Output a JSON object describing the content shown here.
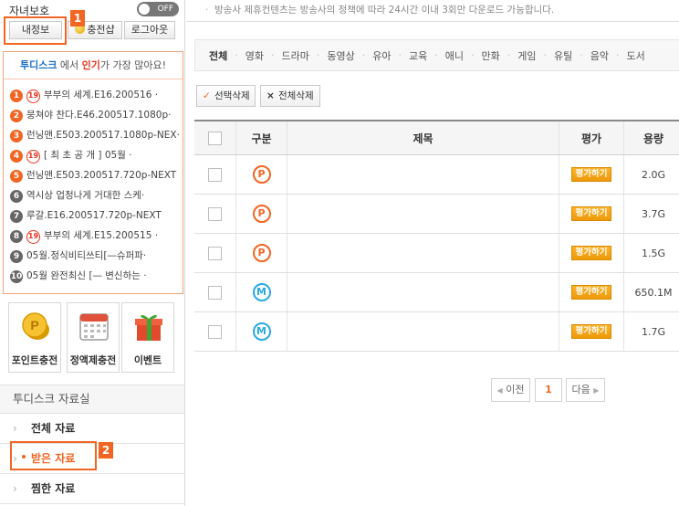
{
  "sidebar": {
    "child_protect_label": "자녀보호",
    "toggle_label": "OFF",
    "buttons": {
      "my_info": "내정보",
      "charge": "충전샵",
      "logout": "로그아웃"
    },
    "highlight_1": "1",
    "highlight_2": "2",
    "popular": {
      "brand": "투디스크",
      "mid": " 에서 ",
      "hot": "인기",
      "tail": "가 가장 많아요!",
      "items": [
        {
          "rank": "1",
          "age": "19",
          "text": "부부의 세계.E16.200516 ·"
        },
        {
          "rank": "2",
          "age": "",
          "text": "뭉쳐야 찬다.E46.200517.1080p·"
        },
        {
          "rank": "3",
          "age": "",
          "text": "런닝맨.E503.200517.1080p-NEX·"
        },
        {
          "rank": "4",
          "age": "19",
          "text": "[ 최 초 공 개 ] 05월 ·"
        },
        {
          "rank": "5",
          "age": "",
          "text": "런닝맨.E503.200517.720p-NEXT"
        },
        {
          "rank": "6",
          "age": "",
          "text": "역시상 업청나게 거대한 스케·"
        },
        {
          "rank": "7",
          "age": "",
          "text": "루갈.E16.200517.720p-NEXT"
        },
        {
          "rank": "8",
          "age": "19",
          "text": "부부의 세계.E15.200515 ·"
        },
        {
          "rank": "9",
          "age": "",
          "text": "05월.정식비티쓰티[—슈퍼파·"
        },
        {
          "rank": "10",
          "age": "",
          "text": "05월 완전최신 [— 변신하는 ·"
        }
      ]
    },
    "tiles": {
      "point": "포인트충전",
      "flat": "정액제충전",
      "event": "이벤트"
    },
    "library": {
      "title": "투디스크 자료실",
      "items": [
        "전체 자료",
        "받은 자료",
        "찜한 자료"
      ]
    }
  },
  "main": {
    "notice": "방송사 제휴컨텐츠는 방송사의 정책에 따라 24시간 이내 3회만 다운로드 가능합니다.",
    "tabs": [
      "전체",
      "영화",
      "드라마",
      "동영상",
      "유아",
      "교육",
      "애니",
      "만화",
      "게임",
      "유틸",
      "음악",
      "도서"
    ],
    "actions": {
      "delete_selected": "선택삭제",
      "delete_all": "전체삭제"
    },
    "table": {
      "headers": {
        "category": "구분",
        "title": "제목",
        "rating": "평가",
        "size": "용량"
      },
      "rate_label": "평가하기",
      "rows": [
        {
          "type": "P",
          "title": "",
          "size": "2.0G"
        },
        {
          "type": "P",
          "title": "",
          "size": "3.7G"
        },
        {
          "type": "P",
          "title": "",
          "size": "1.5G"
        },
        {
          "type": "M",
          "title": "",
          "size": "650.1M"
        },
        {
          "type": "M",
          "title": "",
          "size": "1.7G"
        }
      ]
    },
    "pagination": {
      "prev": "이전",
      "current": "1",
      "next": "다음"
    }
  },
  "colors": {
    "accent": "#f26522",
    "mobile_badge": "#29a9e1",
    "rate_button": "#f5a61a",
    "brand_blue": "#1a6fc6"
  }
}
